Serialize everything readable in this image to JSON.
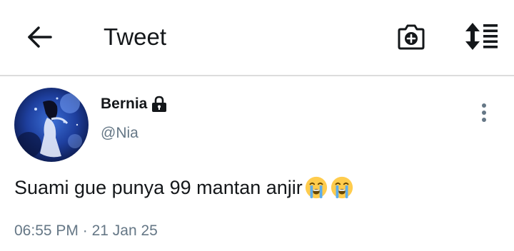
{
  "header": {
    "title": "Tweet",
    "back_icon": "arrow-left-icon",
    "camera_icon": "camera-plus-icon",
    "sort_icon": "sort-list-icon"
  },
  "tweet": {
    "display_name": "Bernia",
    "locked_icon": "lock-icon",
    "handle": "@Nia",
    "text": "Suami gue punya 99 mantan anjir",
    "emojis": [
      "loudly-crying-face",
      "loudly-crying-face"
    ],
    "time": "06:55 PM",
    "separator": "·",
    "date": "21 Jan 25",
    "more_icon": "more-vertical-icon"
  },
  "colors": {
    "text_primary": "#14171a",
    "text_secondary": "#657786",
    "divider": "#dcdcdc",
    "background": "#ffffff"
  }
}
